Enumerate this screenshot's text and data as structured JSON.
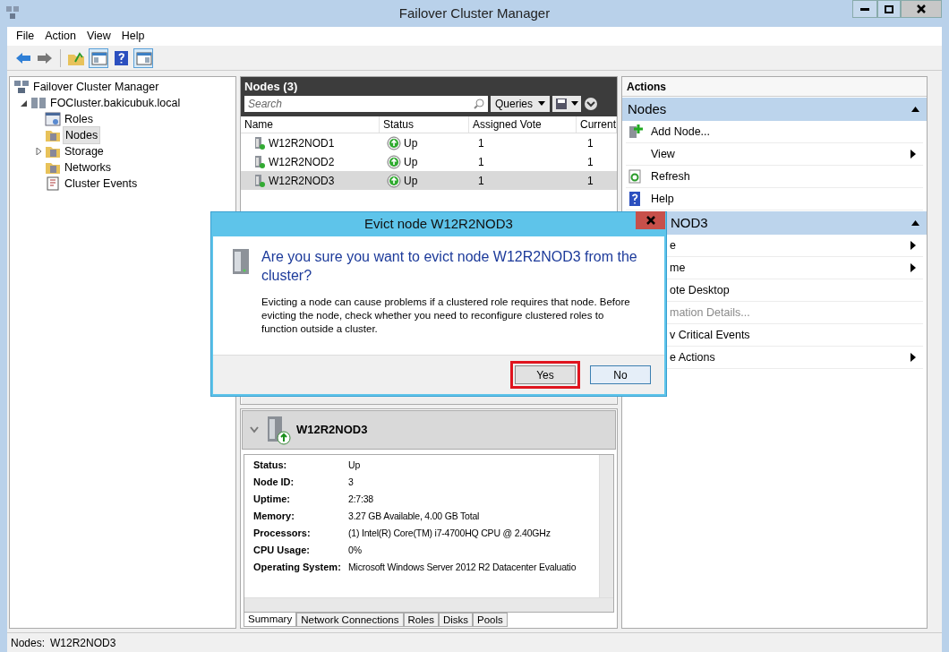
{
  "window": {
    "title": "Failover Cluster Manager"
  },
  "menu": [
    "File",
    "Action",
    "View",
    "Help"
  ],
  "tree": {
    "label": "Failover Cluster Manager",
    "children": [
      {
        "label": "FOCluster.bakicubuk.local",
        "expanded": true,
        "selected": false,
        "children": [
          {
            "label": "Roles",
            "selected": false
          },
          {
            "label": "Nodes",
            "selected": true
          },
          {
            "label": "Storage",
            "selected": false,
            "expanded": false
          },
          {
            "label": "Networks",
            "selected": false
          },
          {
            "label": "Cluster Events",
            "selected": false
          }
        ]
      }
    ]
  },
  "nodes_panel": {
    "title": "Nodes (3)",
    "search": {
      "placeholder": "Search"
    },
    "queries": "Queries",
    "columns": [
      "Name",
      "Status",
      "Assigned Vote",
      "Current"
    ],
    "rows": [
      {
        "name": "W12R2NOD1",
        "status": "Up",
        "assigned_vote": "1",
        "current": "1",
        "selected": false
      },
      {
        "name": "W12R2NOD2",
        "status": "Up",
        "assigned_vote": "1",
        "current": "1",
        "selected": false
      },
      {
        "name": "W12R2NOD3",
        "status": "Up",
        "assigned_vote": "1",
        "current": "1",
        "selected": true
      }
    ]
  },
  "detail": {
    "title": "W12R2NOD3",
    "fields": [
      {
        "label": "Status:",
        "value": "Up"
      },
      {
        "label": "Node ID:",
        "value": "3"
      },
      {
        "label": "Uptime:",
        "value": "2:7:38"
      },
      {
        "label": "Memory:",
        "value": "3.27 GB Available, 4.00 GB Total"
      },
      {
        "label": "Processors:",
        "value": "(1) Intel(R) Core(TM) i7-4700HQ CPU @ 2.40GHz"
      },
      {
        "label": "CPU Usage:",
        "value": "0%"
      },
      {
        "label": "Operating System:",
        "value": "Microsoft Windows Server 2012 R2 Datacenter Evaluatio"
      }
    ],
    "tabs": [
      {
        "label": "Summary",
        "selected": true
      },
      {
        "label": "Network Connections",
        "selected": false
      },
      {
        "label": "Roles",
        "selected": false
      },
      {
        "label": "Disks",
        "selected": false
      },
      {
        "label": "Pools",
        "selected": false
      }
    ]
  },
  "actions": {
    "title": "Actions",
    "sections": [
      {
        "title": "Nodes",
        "items": [
          {
            "label": "Add Node...",
            "kind": "add",
            "submenu": false,
            "disabled": false
          },
          {
            "label": "View",
            "kind": "plain",
            "submenu": true,
            "disabled": false
          },
          {
            "label": "Refresh",
            "kind": "refresh",
            "submenu": false,
            "disabled": false
          },
          {
            "label": "Help",
            "kind": "help",
            "submenu": false,
            "disabled": false
          }
        ]
      },
      {
        "title": "NOD3",
        "items": [
          {
            "label": "e",
            "kind": "plain",
            "submenu": true,
            "disabled": false
          },
          {
            "label": "me",
            "kind": "plain",
            "submenu": true,
            "disabled": false
          },
          {
            "label": "ote Desktop",
            "kind": "plain",
            "submenu": false,
            "disabled": false
          },
          {
            "label": "mation Details...",
            "kind": "plain",
            "submenu": false,
            "disabled": true
          },
          {
            "label": "v Critical Events",
            "kind": "plain",
            "submenu": false,
            "disabled": false
          },
          {
            "label": "e Actions",
            "kind": "plain",
            "submenu": true,
            "disabled": false
          }
        ]
      }
    ]
  },
  "dialog": {
    "title": "Evict node W12R2NOD3",
    "heading": "Are you sure you want to evict node W12R2NOD3 from the cluster?",
    "message": "Evicting a node can cause problems if a clustered role requires that node.  Before evicting the node, check whether you need to reconfigure clustered roles to function outside a cluster.",
    "buttons": [
      {
        "label": "Yes",
        "highlighted": true
      },
      {
        "label": "No",
        "highlighted": false
      }
    ]
  },
  "status_bar": {
    "label": "Nodes:",
    "value": "W12R2NOD3"
  }
}
